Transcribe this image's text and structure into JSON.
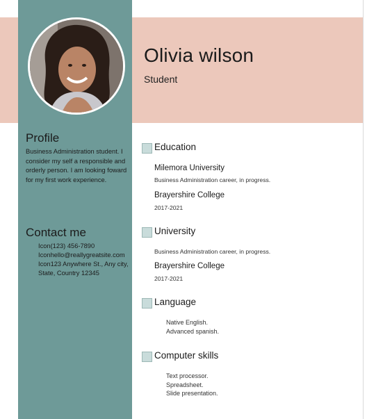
{
  "header": {
    "name": "Olivia wilson",
    "role": "Student"
  },
  "photo": {
    "description_icon": "portrait-photo"
  },
  "profile": {
    "heading": "Profile",
    "text": "Business Administration student. I consider my self a responsible and orderly person. I am looking foward for my first work experience."
  },
  "contact": {
    "heading": "Contact me",
    "items": [
      "Icon(123) 456-7890",
      "Iconhello@reallygreatsite.com",
      "Icon123 Anywhere St., Any city, State, Country 12345"
    ]
  },
  "education": {
    "heading": "Education",
    "entries": [
      {
        "title": "Milemora University",
        "detail": "Business Administration career, in progress."
      },
      {
        "title": "Brayershire College",
        "detail": "2017-2021"
      }
    ]
  },
  "university": {
    "heading": "University",
    "entries": [
      {
        "detail": "Business Administration career, in progress."
      },
      {
        "title": "Brayershire College",
        "detail": "2017-2021"
      }
    ]
  },
  "language": {
    "heading": "Language",
    "items": [
      "Native English.",
      "Advanced spanish."
    ]
  },
  "skills": {
    "heading": "Computer skills",
    "items": [
      "Text processor.",
      "Spreadsheet.",
      "Slide presentation."
    ]
  },
  "colors": {
    "sidebar": "#6e9a98",
    "header_band": "#ecc8bb",
    "section_marker": "#c9dcdb"
  }
}
